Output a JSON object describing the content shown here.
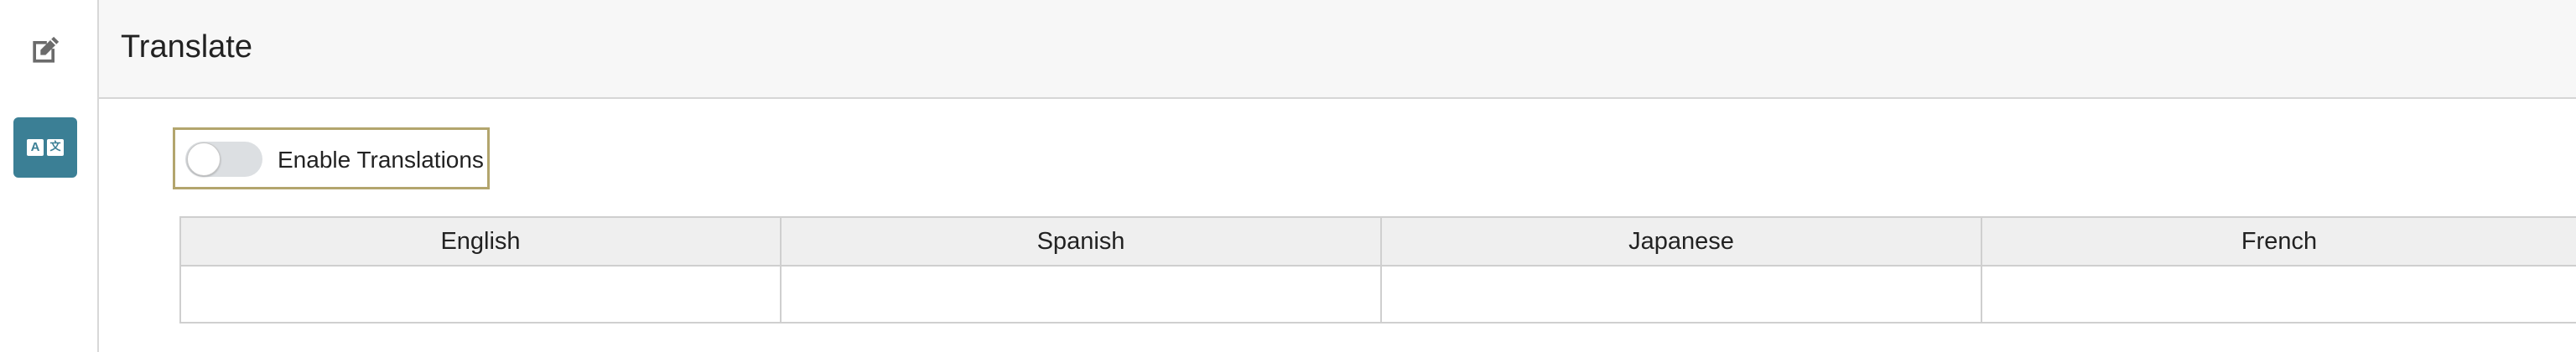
{
  "rail": {
    "items": [
      {
        "icon": "edit-icon",
        "active": false
      },
      {
        "icon": "translate-icon",
        "active": true,
        "glyph_left": "A",
        "glyph_right": "文"
      }
    ],
    "active_color": "#3b7f95"
  },
  "header": {
    "title": "Translate"
  },
  "toggle": {
    "label": "Enable Translations",
    "enabled": false
  },
  "table": {
    "columns": [
      "English",
      "Spanish",
      "Japanese",
      "French"
    ],
    "rows": [
      [
        "",
        "",
        "",
        ""
      ]
    ]
  },
  "colors": {
    "toggle_border": "#b3a56d",
    "header_bg": "#f7f7f7",
    "table_header_bg": "#efefef"
  }
}
